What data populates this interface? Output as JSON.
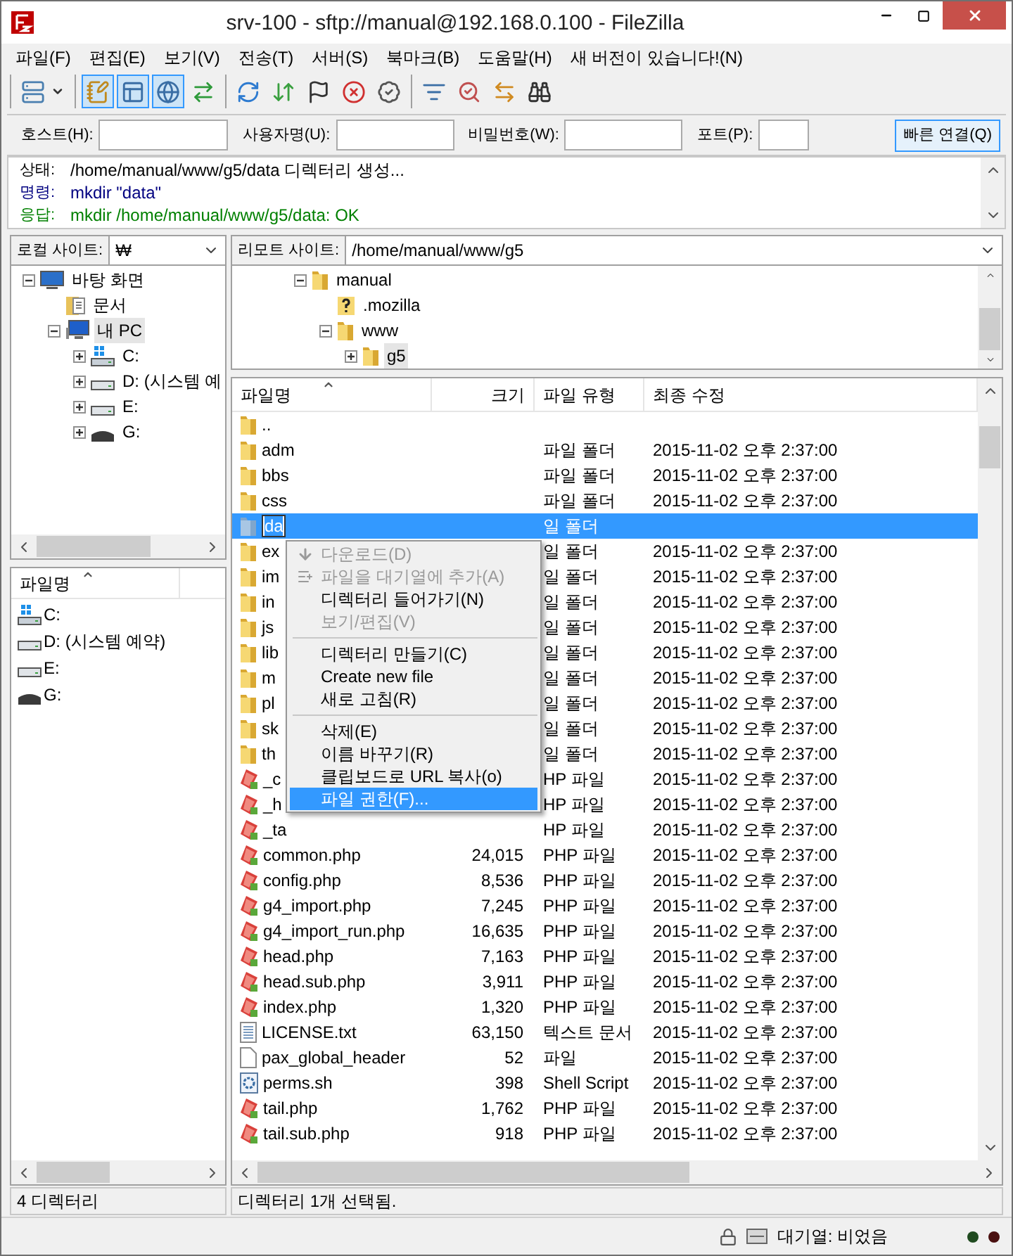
{
  "window": {
    "title": "srv-100 - sftp://manual@192.168.0.100 - FileZilla"
  },
  "menu": [
    "파일(F)",
    "편집(E)",
    "보기(V)",
    "전송(T)",
    "서버(S)",
    "북마크(B)",
    "도움말(H)",
    "새 버전이 있습니다!(N)"
  ],
  "toolbar_groups": [
    {
      "buttons": [
        {
          "pressed": false,
          "dropdown": true
        }
      ]
    },
    {
      "buttons": [
        {
          "pressed": true,
          "dropdown": false
        },
        {
          "pressed": true,
          "dropdown": false
        },
        {
          "pressed": true,
          "dropdown": false
        },
        {
          "pressed": false,
          "dropdown": false
        }
      ]
    },
    {
      "buttons": [
        {
          "pressed": false,
          "dropdown": false
        },
        {
          "pressed": false,
          "dropdown": false
        },
        {
          "pressed": false,
          "dropdown": false
        },
        {
          "pressed": false,
          "dropdown": false
        },
        {
          "pressed": false,
          "dropdown": false
        }
      ]
    },
    {
      "buttons": [
        {
          "pressed": false,
          "dropdown": false
        },
        {
          "pressed": false,
          "dropdown": false
        },
        {
          "pressed": false,
          "dropdown": false
        },
        {
          "pressed": false,
          "dropdown": false
        }
      ]
    }
  ],
  "quickconnect": {
    "fields": [
      {
        "label": "호스트(H):"
      },
      {
        "label": "사용자명(U):"
      },
      {
        "label": "비밀번호(W):"
      },
      {
        "label": "포트(P):"
      }
    ],
    "button": "빠른 연결(Q)"
  },
  "log": [
    {
      "kind": "status",
      "label": "상태:",
      "text": "/home/manual/www/g5/data 디렉터리 생성..."
    },
    {
      "kind": "command",
      "label": "명령:",
      "text": "mkdir \"data\""
    },
    {
      "kind": "response",
      "label": "응답:",
      "text": "mkdir /home/manual/www/g5/data: OK"
    }
  ],
  "local": {
    "site_label": "로컬 사이트:",
    "site_path": "₩",
    "tree": [
      {
        "label": "바탕 화면",
        "kind": "desktop",
        "expander": true,
        "expanded": true,
        "selected": false,
        "children": [
          {
            "label": "문서",
            "kind": "documents",
            "expander": false,
            "expanded": false,
            "selected": false
          },
          {
            "label": "내 PC",
            "kind": "computer",
            "expander": true,
            "expanded": true,
            "selected": true,
            "children": [
              {
                "label": "C:",
                "kind": "drive_windows",
                "expander": true,
                "expanded": false,
                "selected": false
              },
              {
                "label": "D: (시스템 예",
                "kind": "drive",
                "expander": true,
                "expanded": false,
                "selected": false
              },
              {
                "label": "E:",
                "kind": "drive",
                "expander": true,
                "expanded": false,
                "selected": false
              },
              {
                "label": "G:",
                "kind": "drive_dark",
                "expander": true,
                "expanded": false,
                "selected": false
              }
            ]
          }
        ]
      }
    ],
    "list": {
      "columns": [
        "파일명"
      ],
      "items": [
        {
          "name": "C:",
          "kind": "drive_windows"
        },
        {
          "name": "D: (시스템 예약)",
          "kind": "drive"
        },
        {
          "name": "E:",
          "kind": "drive"
        },
        {
          "name": "G:",
          "kind": "drive_dark"
        }
      ]
    },
    "status": "4 디렉터리"
  },
  "remote": {
    "site_label": "리모트 사이트:",
    "site_path": "/home/manual/www/g5",
    "tree": [
      {
        "label": "manual",
        "kind": "folder",
        "expander": true,
        "expanded": true,
        "selected": false,
        "children": [
          {
            "label": ".mozilla",
            "kind": "unknown_folder",
            "expander": false,
            "expanded": false,
            "selected": false
          },
          {
            "label": "www",
            "kind": "folder",
            "expander": true,
            "expanded": true,
            "selected": false,
            "children": [
              {
                "label": "g5",
                "kind": "folder",
                "expander": true,
                "expanded": false,
                "selected": true
              }
            ]
          }
        ]
      }
    ],
    "list": {
      "columns": [
        "파일명",
        "크기",
        "파일 유형",
        "최종 수정"
      ],
      "rows": [
        {
          "name": "..",
          "kind": "folder",
          "selected": false,
          "editing": false
        },
        {
          "name": "adm",
          "kind": "folder",
          "type": "파일 폴더",
          "modified": "2015-11-02 오후 2:37:00",
          "selected": false,
          "editing": false
        },
        {
          "name": "bbs",
          "kind": "folder",
          "type": "파일 폴더",
          "modified": "2015-11-02 오후 2:37:00",
          "selected": false,
          "editing": false
        },
        {
          "name": "css",
          "kind": "folder",
          "type": "파일 폴더",
          "modified": "2015-11-02 오후 2:37:00",
          "selected": false,
          "editing": false
        },
        {
          "name": "da",
          "kind": "folder",
          "type": "일 폴더",
          "selected": true,
          "editing": true
        },
        {
          "name": "ex",
          "kind": "folder",
          "type": "일 폴더",
          "modified": "2015-11-02 오후 2:37:00",
          "selected": false,
          "editing": false
        },
        {
          "name": "im",
          "kind": "folder",
          "type": "일 폴더",
          "modified": "2015-11-02 오후 2:37:00",
          "selected": false,
          "editing": false
        },
        {
          "name": "in",
          "kind": "folder",
          "type": "일 폴더",
          "modified": "2015-11-02 오후 2:37:00",
          "selected": false,
          "editing": false
        },
        {
          "name": "js",
          "kind": "folder",
          "type": "일 폴더",
          "modified": "2015-11-02 오후 2:37:00",
          "selected": false,
          "editing": false
        },
        {
          "name": "lib",
          "kind": "folder",
          "type": "일 폴더",
          "modified": "2015-11-02 오후 2:37:00",
          "selected": false,
          "editing": false
        },
        {
          "name": "m",
          "kind": "folder",
          "type": "일 폴더",
          "modified": "2015-11-02 오후 2:37:00",
          "selected": false,
          "editing": false
        },
        {
          "name": "pl",
          "kind": "folder",
          "type": "일 폴더",
          "modified": "2015-11-02 오후 2:37:00",
          "selected": false,
          "editing": false
        },
        {
          "name": "sk",
          "kind": "folder",
          "type": "일 폴더",
          "modified": "2015-11-02 오후 2:37:00",
          "selected": false,
          "editing": false
        },
        {
          "name": "th",
          "kind": "folder",
          "type": "일 폴더",
          "modified": "2015-11-02 오후 2:37:00",
          "selected": false,
          "editing": false
        },
        {
          "name": "_c",
          "kind": "php",
          "type": "HP 파일",
          "modified": "2015-11-02 오후 2:37:00",
          "selected": false,
          "editing": false
        },
        {
          "name": "_h",
          "kind": "php",
          "type": "HP 파일",
          "modified": "2015-11-02 오후 2:37:00",
          "selected": false,
          "editing": false
        },
        {
          "name": "_ta",
          "kind": "php",
          "type": "HP 파일",
          "modified": "2015-11-02 오후 2:37:00",
          "selected": false,
          "editing": false
        },
        {
          "name": "common.php",
          "kind": "php",
          "size": "24,015",
          "type": "PHP 파일",
          "modified": "2015-11-02 오후 2:37:00",
          "selected": false,
          "editing": false
        },
        {
          "name": "config.php",
          "kind": "php",
          "size": "8,536",
          "type": "PHP 파일",
          "modified": "2015-11-02 오후 2:37:00",
          "selected": false,
          "editing": false
        },
        {
          "name": "g4_import.php",
          "kind": "php",
          "size": "7,245",
          "type": "PHP 파일",
          "modified": "2015-11-02 오후 2:37:00",
          "selected": false,
          "editing": false
        },
        {
          "name": "g4_import_run.php",
          "kind": "php",
          "size": "16,635",
          "type": "PHP 파일",
          "modified": "2015-11-02 오후 2:37:00",
          "selected": false,
          "editing": false
        },
        {
          "name": "head.php",
          "kind": "php",
          "size": "7,163",
          "type": "PHP 파일",
          "modified": "2015-11-02 오후 2:37:00",
          "selected": false,
          "editing": false
        },
        {
          "name": "head.sub.php",
          "kind": "php",
          "size": "3,911",
          "type": "PHP 파일",
          "modified": "2015-11-02 오후 2:37:00",
          "selected": false,
          "editing": false
        },
        {
          "name": "index.php",
          "kind": "php",
          "size": "1,320",
          "type": "PHP 파일",
          "modified": "2015-11-02 오후 2:37:00",
          "selected": false,
          "editing": false
        },
        {
          "name": "LICENSE.txt",
          "kind": "text",
          "size": "63,150",
          "type": "텍스트 문서",
          "modified": "2015-11-02 오후 2:37:00",
          "selected": false,
          "editing": false
        },
        {
          "name": "pax_global_header",
          "kind": "file",
          "size": "52",
          "type": "파일",
          "modified": "2015-11-02 오후 2:37:00",
          "selected": false,
          "editing": false
        },
        {
          "name": "perms.sh",
          "kind": "script",
          "size": "398",
          "type": "Shell Script",
          "modified": "2015-11-02 오후 2:37:00",
          "selected": false,
          "editing": false
        },
        {
          "name": "tail.php",
          "kind": "php",
          "size": "1,762",
          "type": "PHP 파일",
          "modified": "2015-11-02 오후 2:37:00",
          "selected": false,
          "editing": false
        },
        {
          "name": "tail.sub.php",
          "kind": "php",
          "size": "918",
          "type": "PHP 파일",
          "modified": "2015-11-02 오후 2:37:00",
          "selected": false,
          "editing": false
        }
      ]
    },
    "status": "디렉터리 1개 선택됨."
  },
  "context_menu": [
    {
      "kind": "item",
      "label": "다운로드(D)",
      "disabled": true,
      "selected": false
    },
    {
      "kind": "item",
      "label": "파일을 대기열에 추가(A)",
      "disabled": true,
      "selected": false
    },
    {
      "kind": "item",
      "label": "디렉터리 들어가기(N)",
      "disabled": false,
      "selected": false
    },
    {
      "kind": "item",
      "label": "보기/편집(V)",
      "disabled": true,
      "selected": false
    },
    {
      "kind": "separator"
    },
    {
      "kind": "item",
      "label": "디렉터리 만들기(C)",
      "disabled": false,
      "selected": false
    },
    {
      "kind": "item",
      "label": "Create new file",
      "disabled": false,
      "selected": false
    },
    {
      "kind": "item",
      "label": "새로 고침(R)",
      "disabled": false,
      "selected": false
    },
    {
      "kind": "separator"
    },
    {
      "kind": "item",
      "label": "삭제(E)",
      "disabled": false,
      "selected": false
    },
    {
      "kind": "item",
      "label": "이름 바꾸기(R)",
      "disabled": false,
      "selected": false
    },
    {
      "kind": "item",
      "label": "클립보드로 URL 복사(o)",
      "disabled": false,
      "selected": false
    },
    {
      "kind": "item",
      "label": "파일 권한(F)...",
      "disabled": false,
      "selected": true
    }
  ],
  "status_bar": {
    "queue": "대기열: 비었음"
  }
}
